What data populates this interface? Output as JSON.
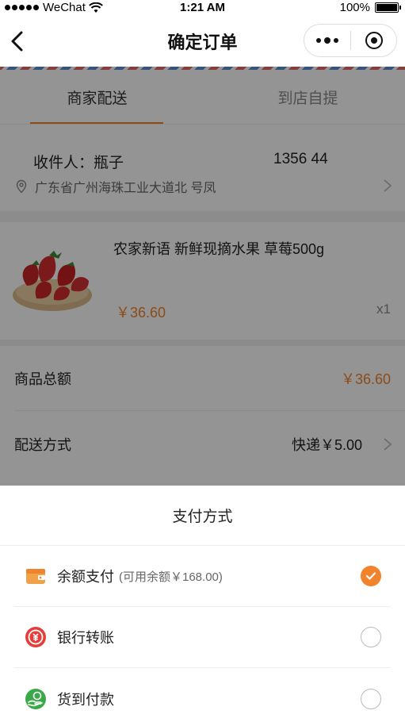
{
  "status_bar": {
    "carrier": "WeChat",
    "time": "1:21 AM",
    "battery": "100%"
  },
  "nav": {
    "title": "确定订单"
  },
  "tabs": [
    {
      "label": "商家配送",
      "active": true
    },
    {
      "label": "到店自提",
      "active": false
    }
  ],
  "address": {
    "receiver": "收件人：瓶子",
    "phone": "1356 44",
    "line": "广东省广州海珠工业大道北 号凤"
  },
  "product": {
    "name": "农家新语 新鲜现摘水果 草莓500g",
    "price": "￥36.60",
    "quantity": "x1"
  },
  "summary": {
    "total_label": "商品总额",
    "total_value": "￥36.60",
    "delivery_label": "配送方式",
    "delivery_value": "快递￥5.00"
  },
  "payment": {
    "title": "支付方式",
    "options": [
      {
        "label": "余额支付",
        "sub": "(可用余额￥168.00)",
        "icon": "wallet-icon",
        "color": "#f0832b",
        "selected": true
      },
      {
        "label": "银行转账",
        "sub": "",
        "icon": "bank-transfer-icon",
        "color": "#e53c3c",
        "selected": false
      },
      {
        "label": "货到付款",
        "sub": "",
        "icon": "cash-on-delivery-icon",
        "color": "#3ba84a",
        "selected": false
      }
    ]
  },
  "colors": {
    "accent": "#f0832b"
  }
}
